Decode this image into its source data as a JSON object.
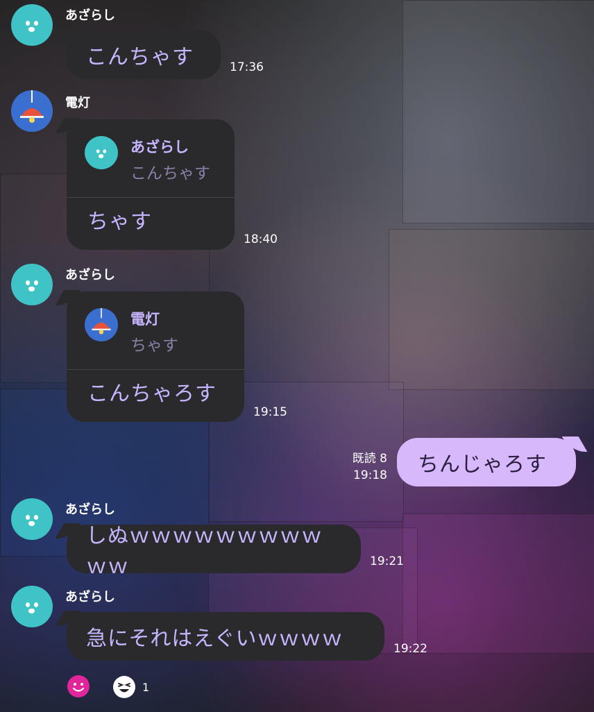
{
  "chat": {
    "messages": [
      {
        "sender": "あざらし",
        "text": "こんちゃす",
        "time": "17:36"
      },
      {
        "sender": "電灯",
        "reply_to": {
          "sender": "あざらし",
          "text": "こんちゃす"
        },
        "text": "ちゃす",
        "time": "18:40"
      },
      {
        "sender": "あざらし",
        "reply_to": {
          "sender": "電灯",
          "text": "ちゃす"
        },
        "text": "こんちゃろす",
        "time": "19:15"
      },
      {
        "sender": "me",
        "read_status": "既読 8",
        "text": "ちんじゃろす",
        "time": "19:18"
      },
      {
        "sender": "あざらし",
        "text": "しぬｗｗｗｗｗｗｗｗｗｗｗ",
        "time": "19:21"
      },
      {
        "sender": "あざらし",
        "text": "急にそれはえぐいｗｗｗｗ",
        "time": "19:22"
      }
    ],
    "reactions": {
      "count": "1"
    }
  },
  "icons": {
    "seal_avatar": "seal-avatar-icon",
    "lamp_avatar": "lamp-avatar-icon",
    "smile_reaction": "smile-reaction-icon",
    "laugh_reaction": "laugh-reaction-icon"
  },
  "colors": {
    "bubble_dark": "#2a2a2c",
    "text_purple": "#c8b5ff",
    "my_bubble": "#d7b8fb",
    "seal_avatar": "#3fc3c6",
    "lamp_avatar": "#3a6fd0"
  }
}
